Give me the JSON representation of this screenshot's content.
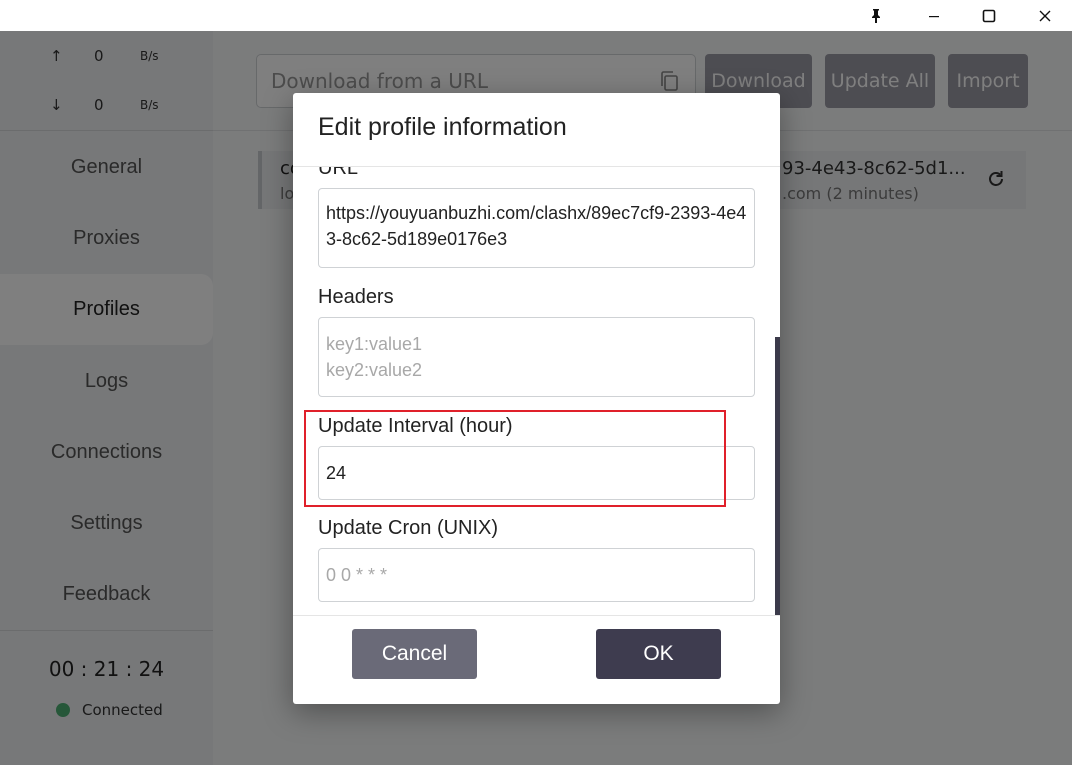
{
  "window": {
    "pin_icon": "pin-icon",
    "minimize_icon": "minimize-icon",
    "maximize_icon": "maximize-icon",
    "close_icon": "close-icon"
  },
  "traffic": {
    "up_arrow": "↑",
    "up_value": "0",
    "up_unit": "B/s",
    "down_arrow": "↓",
    "down_value": "0",
    "down_unit": "B/s"
  },
  "sidebar": {
    "items": [
      {
        "label": "General"
      },
      {
        "label": "Proxies"
      },
      {
        "label": "Profiles",
        "active": true
      },
      {
        "label": "Logs"
      },
      {
        "label": "Connections"
      },
      {
        "label": "Settings"
      },
      {
        "label": "Feedback"
      }
    ],
    "timer": "00 : 21 : 24",
    "status": "Connected",
    "status_color": "#4caf72"
  },
  "toolbar": {
    "url_placeholder": "Download from a URL",
    "download_label": "Download",
    "update_all_label": "Update All",
    "import_label": "Import"
  },
  "profile_card": {
    "name": "co",
    "sub": "lo",
    "url_fragment": "93-4e43-8c62-5d1...",
    "time_fragment": ".com (2 minutes)"
  },
  "dialog": {
    "title": "Edit profile information",
    "url_label": "URL",
    "url_value": "https://youyuanbuzhi.com/clashx/89ec7cf9-2393-4e43-8c62-5d189e0176e3",
    "headers_label": "Headers",
    "headers_placeholder_line1": "key1:value1",
    "headers_placeholder_line2": "key2:value2",
    "interval_label": "Update Interval (hour)",
    "interval_value": "24",
    "cron_label": "Update Cron (UNIX)",
    "cron_placeholder": "0 0 * * *",
    "cancel_label": "Cancel",
    "ok_label": "OK",
    "highlight_color": "#e0202a"
  }
}
